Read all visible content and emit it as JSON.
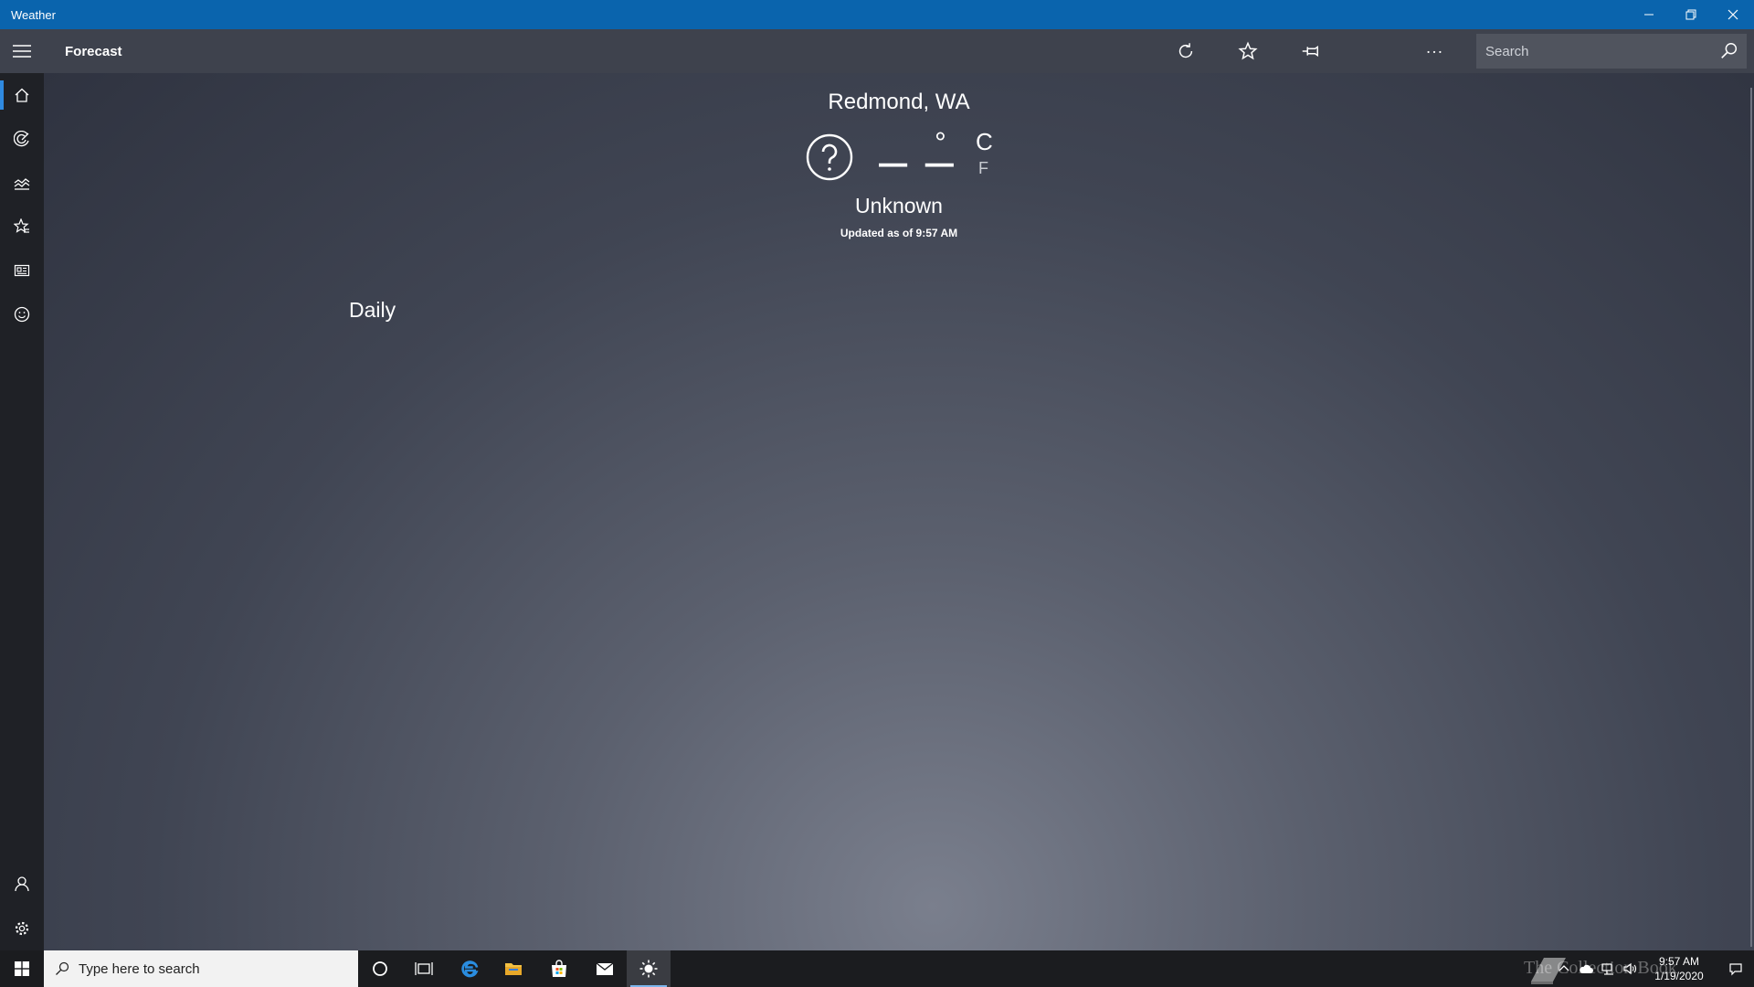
{
  "window": {
    "title": "Weather"
  },
  "header": {
    "page_title": "Forecast",
    "search_placeholder": "Search"
  },
  "nav": {
    "items": [
      "Forecast",
      "Maps",
      "Historical Weather",
      "Favorites",
      "News",
      "Send Feedback"
    ],
    "bottom": [
      "Account",
      "Settings"
    ]
  },
  "current": {
    "location": "Redmond, WA",
    "temperature": "– –",
    "degree_symbol": "°",
    "unit_c": "C",
    "unit_f": "F",
    "condition": "Unknown",
    "updated": "Updated as of 9:57 AM",
    "condition_icon": "question-icon"
  },
  "sections": {
    "daily_heading": "Daily"
  },
  "taskbar": {
    "search_placeholder": "Type here to search",
    "time": "9:57 AM",
    "date": "1/19/2020",
    "watermark": "The Collection Book"
  },
  "colors": {
    "titlebar": "#0a64ad",
    "accent": "#2f8ae0",
    "appbar": "#3e424d",
    "nav": "#1f2126"
  }
}
